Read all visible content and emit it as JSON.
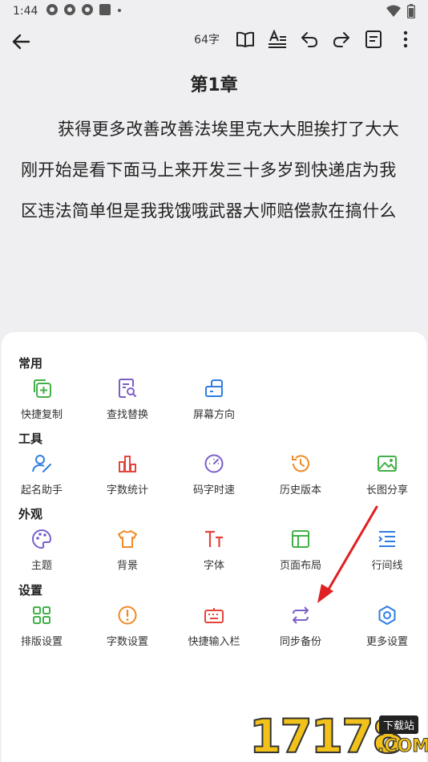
{
  "status_bar": {
    "time": "1:44"
  },
  "toolbar": {
    "word_count": "64字"
  },
  "document": {
    "chapter_title": "第1章",
    "body": "获得更多改善改善法埃里克大大胆挨打了大大刚开始是看下面马上来开发三十多岁到快递店为我区违法简单但是我我饿哦武器大师赔偿款在搞什么"
  },
  "sheet": {
    "sections": [
      {
        "title": "常用",
        "items": [
          {
            "label": "快捷复制",
            "icon": "copy-add-icon"
          },
          {
            "label": "查找替换",
            "icon": "find-replace-icon"
          },
          {
            "label": "屏幕方向",
            "icon": "screen-rotate-icon"
          }
        ]
      },
      {
        "title": "工具",
        "items": [
          {
            "label": "起名助手",
            "icon": "name-helper-icon"
          },
          {
            "label": "字数统计",
            "icon": "bar-chart-icon"
          },
          {
            "label": "码字时速",
            "icon": "speedometer-icon"
          },
          {
            "label": "历史版本",
            "icon": "history-icon"
          },
          {
            "label": "长图分享",
            "icon": "image-share-icon"
          }
        ]
      },
      {
        "title": "外观",
        "items": [
          {
            "label": "主题",
            "icon": "palette-icon"
          },
          {
            "label": "背景",
            "icon": "shirt-icon"
          },
          {
            "label": "字体",
            "icon": "font-icon"
          },
          {
            "label": "页面布局",
            "icon": "layout-icon"
          },
          {
            "label": "行间线",
            "icon": "line-spacing-icon"
          }
        ]
      },
      {
        "title": "设置",
        "items": [
          {
            "label": "排版设置",
            "icon": "grid-layout-icon"
          },
          {
            "label": "字数设置",
            "icon": "alert-circle-icon"
          },
          {
            "label": "快捷输入栏",
            "icon": "keyboard-icon"
          },
          {
            "label": "同步备份",
            "icon": "sync-icon"
          },
          {
            "label": "更多设置",
            "icon": "gear-icon"
          }
        ]
      }
    ]
  },
  "watermark": {
    "digits": "17178",
    "tag": "下载站",
    "com": ".COM"
  },
  "colors": {
    "green": "#43b047",
    "purple": "#7b5fc9",
    "blue": "#2f7de1",
    "red": "#e4453b",
    "orange": "#f08a24",
    "arrow": "#e02020"
  }
}
